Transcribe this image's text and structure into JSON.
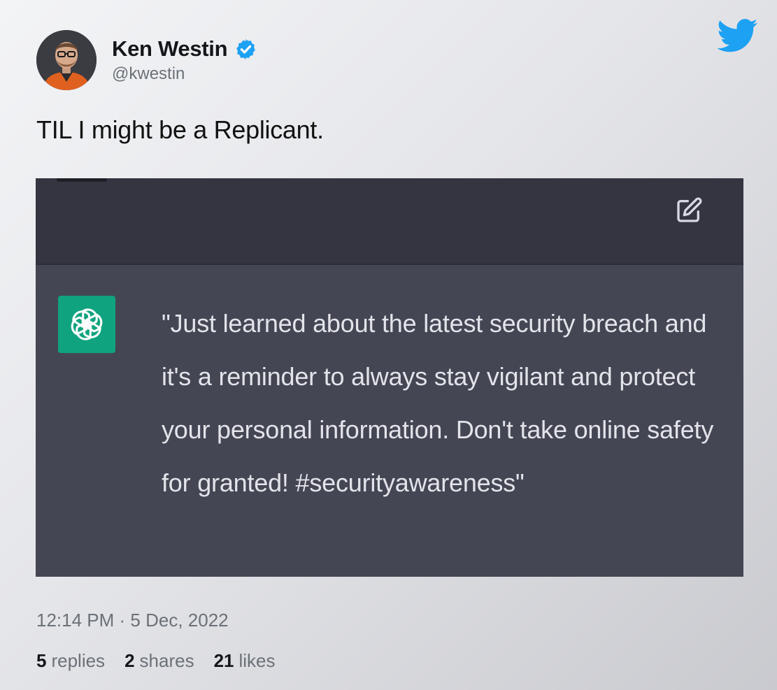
{
  "author": {
    "name": "Ken Westin",
    "handle": "@kwestin",
    "verified": true,
    "avatar_icon": "avatar-photo"
  },
  "tweet": {
    "text": "TIL I might be a Replicant."
  },
  "embedded_screenshot": {
    "edit_icon": "edit-icon",
    "assistant_icon": "openai-logo-icon",
    "message": "\"Just learned about the latest security breach and it's a reminder to always stay vigilant and protect your personal information. Don't take online safety for granted! #securityawareness\""
  },
  "meta": {
    "time": "12:14 PM",
    "separator": " · ",
    "date": "5 Dec, 2022"
  },
  "stats": [
    {
      "count": "5",
      "label": "replies"
    },
    {
      "count": "2",
      "label": "shares"
    },
    {
      "count": "21",
      "label": "likes"
    }
  ],
  "colors": {
    "twitter_blue": "#1da1f2",
    "gpt_green": "#10a37f",
    "embed_background": "#444654",
    "embed_header": "#343541"
  },
  "icons": {
    "bird": "twitter-bird-icon",
    "verified": "verified-badge-icon"
  }
}
